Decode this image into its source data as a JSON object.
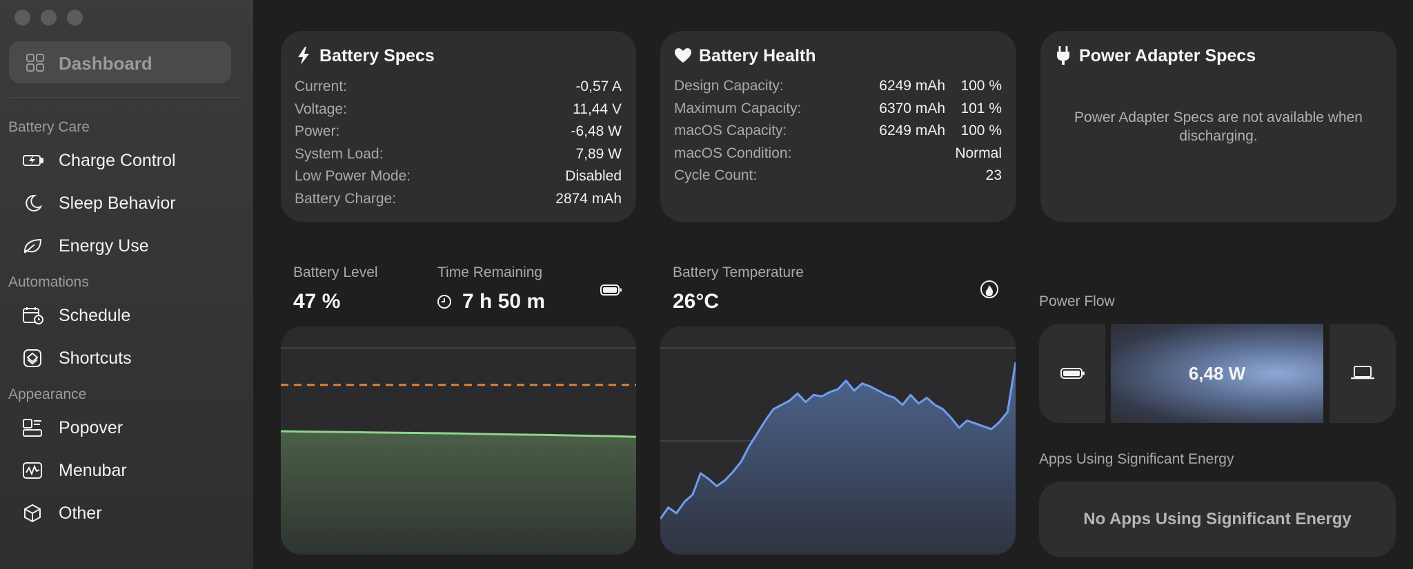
{
  "sidebar": {
    "dashboard_label": "Dashboard",
    "sections": [
      {
        "title": "Battery Care",
        "items": [
          {
            "label": "Charge Control",
            "icon": "battery-bolt-icon"
          },
          {
            "label": "Sleep Behavior",
            "icon": "moon-icon"
          },
          {
            "label": "Energy Use",
            "icon": "leaf-icon"
          }
        ]
      },
      {
        "title": "Automations",
        "items": [
          {
            "label": "Schedule",
            "icon": "calendar-clock-icon"
          },
          {
            "label": "Shortcuts",
            "icon": "shortcuts-icon"
          }
        ]
      },
      {
        "title": "Appearance",
        "items": [
          {
            "label": "Popover",
            "icon": "popover-icon"
          },
          {
            "label": "Menubar",
            "icon": "menubar-icon"
          },
          {
            "label": "Other",
            "icon": "cube-icon"
          }
        ]
      }
    ]
  },
  "battery_specs": {
    "title": "Battery Specs",
    "rows": [
      {
        "k": "Current:",
        "v": "-0,57 A"
      },
      {
        "k": "Voltage:",
        "v": "11,44 V"
      },
      {
        "k": "Power:",
        "v": "-6,48 W"
      },
      {
        "k": "System Load:",
        "v": "7,89 W"
      },
      {
        "k": "Low Power Mode:",
        "v": "Disabled"
      },
      {
        "k": "Battery Charge:",
        "v": "2874 mAh"
      }
    ]
  },
  "battery_health": {
    "title": "Battery Health",
    "rows": [
      {
        "k": "Design Capacity:",
        "v1": "6249 mAh",
        "v2": "100 %"
      },
      {
        "k": "Maximum Capacity:",
        "v1": "6370 mAh",
        "v2": "101 %"
      },
      {
        "k": "macOS Capacity:",
        "v1": "6249 mAh",
        "v2": "100 %"
      },
      {
        "k": "macOS Condition:",
        "v2": "Normal"
      },
      {
        "k": "Cycle Count:",
        "v2": "23"
      }
    ]
  },
  "power_adapter": {
    "title": "Power Adapter Specs",
    "message": "Power Adapter Specs are not available when discharging."
  },
  "battery_level": {
    "label": "Battery Level",
    "value": "47 %"
  },
  "time_remaining": {
    "label": "Time Remaining",
    "value": "7 h 50 m"
  },
  "battery_temperature": {
    "label": "Battery Temperature",
    "value": "26°C"
  },
  "power_flow": {
    "label": "Power Flow",
    "value": "6,48 W"
  },
  "apps": {
    "label": "Apps Using Significant Energy",
    "message": "No Apps Using Significant Energy"
  },
  "colors": {
    "level_line": "#8fd48a",
    "threshold_line": "#d9823b",
    "temp_line": "#6f9ef0"
  },
  "chart_data": [
    {
      "type": "area",
      "series": [
        {
          "values": [
            0.55,
            0.548,
            0.546,
            0.544,
            0.542,
            0.54,
            0.538,
            0.535,
            0.532,
            0.53,
            0.527,
            0.524,
            0.52
          ]
        }
      ],
      "threshold": 0.8,
      "ylim": [
        0,
        1
      ]
    },
    {
      "type": "area",
      "series": [
        {
          "values": [
            0.1,
            0.18,
            0.14,
            0.22,
            0.27,
            0.42,
            0.38,
            0.33,
            0.37,
            0.43,
            0.5,
            0.61,
            0.7,
            0.79,
            0.87,
            0.9,
            0.93,
            0.98,
            0.92,
            0.97,
            0.96,
            0.99,
            1.01,
            1.07,
            1.0,
            1.05,
            1.03,
            1.0,
            0.97,
            0.95,
            0.9,
            0.97,
            0.91,
            0.95,
            0.9,
            0.87,
            0.81,
            0.74,
            0.79,
            0.77,
            0.75,
            0.73,
            0.78,
            0.85,
            1.2
          ]
        }
      ],
      "ylim": [
        0,
        1.3
      ]
    }
  ]
}
